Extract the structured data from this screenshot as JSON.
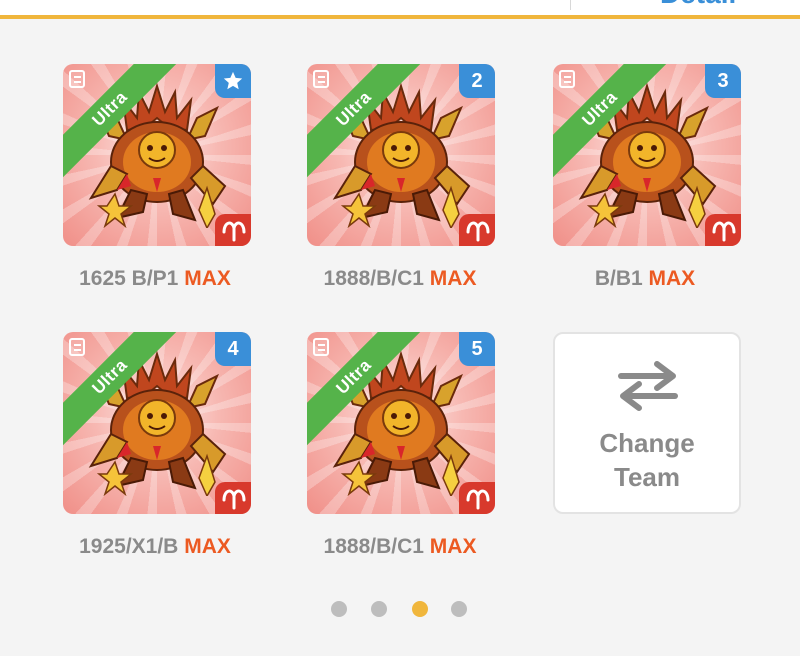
{
  "header": {
    "detail_label": "Detail",
    "accent_color": "#f0b63c"
  },
  "team": [
    {
      "rarity": "Ultra",
      "slot": "★",
      "slot_icon": "star-icon",
      "name": "1625 B/P1",
      "level": "MAX",
      "sign_icon": "aries-icon"
    },
    {
      "rarity": "Ultra",
      "slot": "2",
      "name": "1888/B/C1",
      "level": "MAX",
      "sign_icon": "aries-icon"
    },
    {
      "rarity": "Ultra",
      "slot": "3",
      "name": "B/B1",
      "level": "MAX",
      "sign_icon": "aries-icon"
    },
    {
      "rarity": "Ultra",
      "slot": "4",
      "name": "1925/X1/B",
      "level": "MAX",
      "sign_icon": "aries-icon"
    },
    {
      "rarity": "Ultra",
      "slot": "5",
      "name": "1888/B/C1",
      "level": "MAX",
      "sign_icon": "aries-icon"
    }
  ],
  "change_team": {
    "line1": "Change",
    "line2": "Team",
    "icon": "swap-arrows-icon"
  },
  "pagination": {
    "total": 4,
    "active_page": 3
  },
  "colors": {
    "ribbon": "#55b34a",
    "slot_badge": "#3a8fd8",
    "sign_badge": "#d8392c",
    "max_text": "#ec5a22"
  }
}
